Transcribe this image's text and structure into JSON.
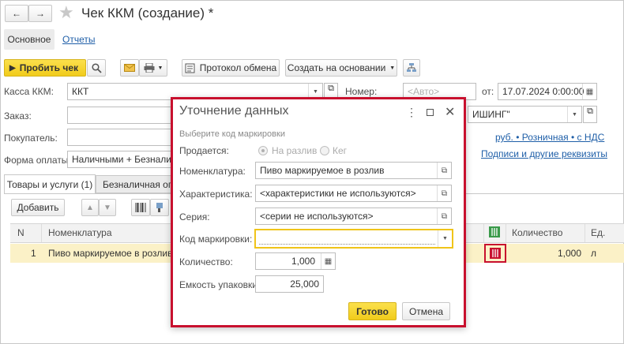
{
  "window": {
    "title": "Чек ККМ (создание) *"
  },
  "tabs": {
    "main": "Основное",
    "reports": "Отчеты"
  },
  "toolbar": {
    "punch": "Пробить чек",
    "exchange_log": "Протокол обмена",
    "create_based": "Создать на основании"
  },
  "form": {
    "kassa_label": "Касса ККМ:",
    "kassa_value": "ККТ",
    "number_label": "Номер:",
    "number_placeholder": "<Авто>",
    "date_label": "от:",
    "date_value": "17.07.2024  0:00:00",
    "order_label": "Заказ:",
    "buyer_label": "Покупатель:",
    "org_value": "ИШИНГ\"",
    "payment_label": "Форма оплаты:",
    "payment_value": "Наличными + Безналичн",
    "price_link": "руб. • Розничная • с НДС",
    "sign_link": "Подписи и другие реквизиты"
  },
  "doc_tabs": {
    "goods": "Товары и услуги (1)",
    "cashless": "Безналичная опл"
  },
  "table": {
    "add_button": "Добавить",
    "col_n": "N",
    "col_nom": "Номенклатура",
    "col_qty": "Количество",
    "col_unit": "Ед.",
    "row": {
      "n": "1",
      "nom": "Пиво маркируемое в розлив",
      "qty": "1,000",
      "unit": "л"
    }
  },
  "dialog": {
    "title": "Уточнение данных",
    "subtitle": "Выберите код маркировки",
    "sold_label": "Продается:",
    "opt_draft": "На разлив",
    "opt_keg": "Кег",
    "nom_label": "Номенклатура:",
    "nom_value": "Пиво маркируемое в розлив",
    "char_label": "Характеристика:",
    "char_value": "<характеристики не используются>",
    "series_label": "Серия:",
    "series_value": "<серии не используются>",
    "code_label": "Код маркировки:",
    "code_value": "",
    "qty_label": "Количество:",
    "qty_value": "1,000",
    "pack_label": "Емкость упаковки:",
    "pack_value": "25,000",
    "ok_button": "Готово",
    "cancel_button": "Отмена"
  },
  "colors": {
    "accent_yellow": "#f5d531",
    "highlight_red": "#c8102e",
    "row_highlight": "#fbf1c7",
    "link": "#1f5fa8"
  }
}
